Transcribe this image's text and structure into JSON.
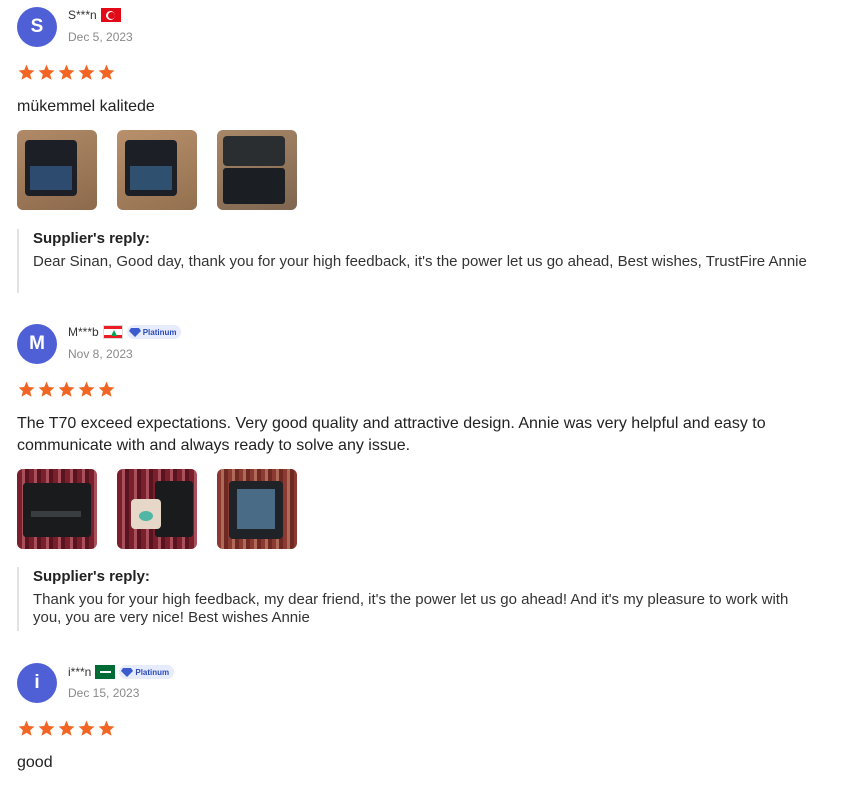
{
  "reviews": [
    {
      "avatar_letter": "S",
      "name": "S***n",
      "country": "Turkey",
      "badge": "",
      "date": "Dec 5, 2023",
      "rating": 5,
      "text": "mükemmel kalitede",
      "reply_title": "Supplier's reply:",
      "reply_text": "Dear Sinan, Good day, thank you for your high feedback, it's the power let us go ahead, Best wishes, TrustFire Annie"
    },
    {
      "avatar_letter": "M",
      "name": "M***b",
      "country": "Lebanon",
      "badge": "Platinum",
      "date": "Nov 8, 2023",
      "rating": 5,
      "text": "The T70 exceed expectations. Very good quality and attractive design. Annie was very helpful and easy to communicate with and always ready to solve any issue.",
      "reply_title": "Supplier's reply:",
      "reply_text": "Thank you for your high feedback, my dear friend, it's the power let us go ahead! And it's my pleasure to work with you, you are very nice! Best wishes Annie"
    },
    {
      "avatar_letter": "i",
      "name": "i***n",
      "country": "Saudi Arabia",
      "badge": "Platinum",
      "date": "Dec 15, 2023",
      "rating": 5,
      "text": "good"
    }
  ],
  "colors": {
    "avatar": "#4f60d6",
    "star": "#f26522",
    "badge_bg": "#e7ecfd",
    "badge_text": "#2a4ab8"
  },
  "icons": {
    "star": "star-icon",
    "badge": "diamond-icon"
  }
}
